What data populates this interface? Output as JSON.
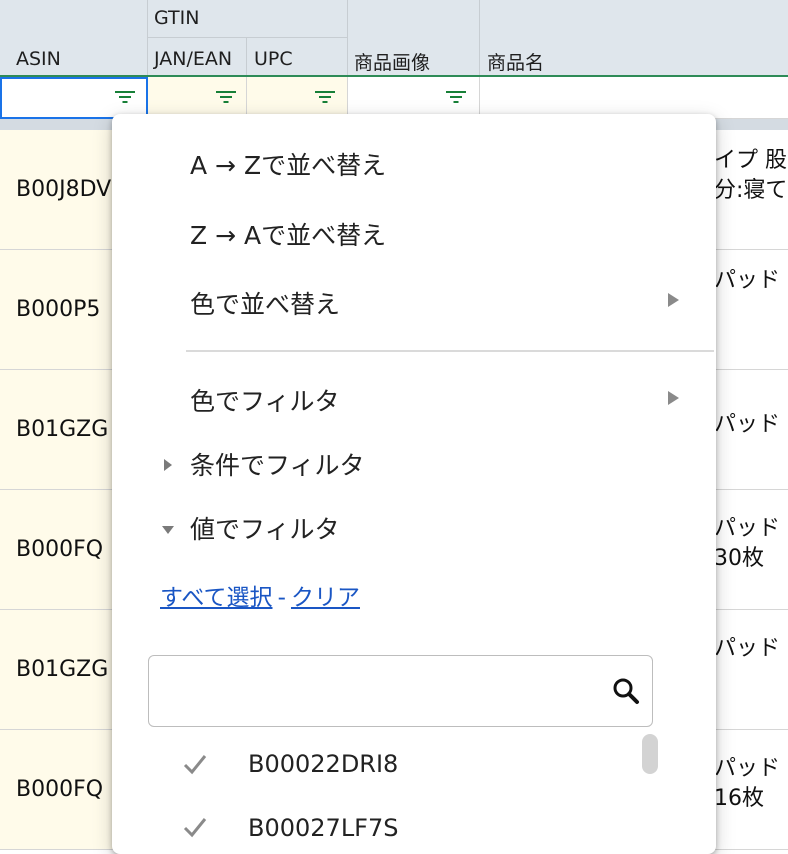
{
  "header": {
    "gtin": "GTIN",
    "asin": "ASIN",
    "jan_ean": "JAN/EAN",
    "upc": "UPC",
    "image": "商品画像",
    "name": "商品名"
  },
  "rows": [
    {
      "asin": "B00J8DV",
      "name_lines": [
        "イプ 股",
        "分:寝て"
      ]
    },
    {
      "asin": "B000P5",
      "name_lines": [
        "パッド"
      ]
    },
    {
      "asin": "B01GZG",
      "name_lines": [
        "パッド"
      ]
    },
    {
      "asin": "B000FQ",
      "name_lines": [
        "パッド",
        "30枚"
      ]
    },
    {
      "asin": "B01GZG",
      "name_lines": [
        "パッド"
      ]
    },
    {
      "asin": "B000FQ",
      "name_lines": [
        "パッド",
        "16枚"
      ]
    }
  ],
  "menu": {
    "sort_az": "A → Zで並べ替え",
    "sort_za": "Z → Aで並べ替え",
    "sort_color": "色で並べ替え",
    "filter_color": "色でフィルタ",
    "filter_condition": "条件でフィルタ",
    "filter_value": "値でフィルタ",
    "select_all": "すべて選択",
    "separator": "-",
    "clear": "クリア",
    "search_placeholder": "",
    "values": [
      "B00022DRI8",
      "B00027LF7S"
    ]
  },
  "colors": {
    "header_bg": "#dfe6ec",
    "filter_icon": "#188038",
    "link": "#1a56c4",
    "active_cell_border": "#1a73e8",
    "cell_highlight": "#fffbea"
  }
}
